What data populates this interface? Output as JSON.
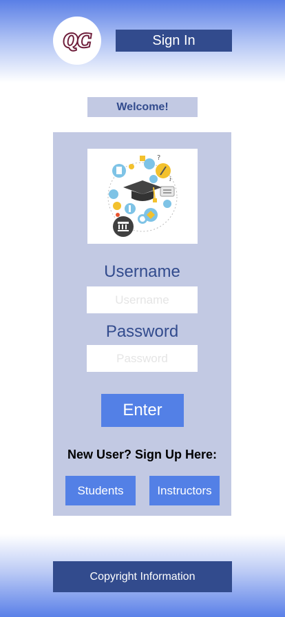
{
  "header": {
    "logo_text": "QC",
    "signin_label": "Sign In"
  },
  "welcome": "Welcome!",
  "form": {
    "illustration_icon": "education-graduation-cap-icon",
    "username_label": "Username",
    "username_placeholder": "Username",
    "username_value": "",
    "password_label": "Password",
    "password_placeholder": "Password",
    "password_value": "",
    "enter_label": "Enter"
  },
  "signup": {
    "prompt": "New User? Sign Up Here:",
    "students_label": "Students",
    "instructors_label": "Instructors"
  },
  "footer": {
    "copyright_label": "Copyright Information"
  },
  "colors": {
    "dark_blue": "#324b8d",
    "accent_blue": "#5380e6",
    "panel_lavender": "#c2c9e3"
  }
}
